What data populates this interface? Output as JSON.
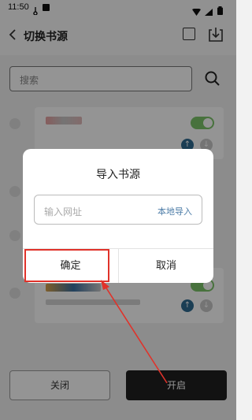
{
  "status_bar": {
    "time": "11:50"
  },
  "header": {
    "title": "切换书源"
  },
  "search": {
    "placeholder": "搜索"
  },
  "bottom": {
    "close_label": "关闭",
    "enable_label": "开启"
  },
  "dialog": {
    "title": "导入书源",
    "url_placeholder": "输入网址",
    "local_import": "本地导入",
    "confirm_label": "确定",
    "cancel_label": "取消"
  },
  "colors": {
    "accent": "#4d7da8",
    "toggle_on": "#7cc46a",
    "annotation": "#e0322a",
    "primary_button": "#1f1f1f"
  }
}
